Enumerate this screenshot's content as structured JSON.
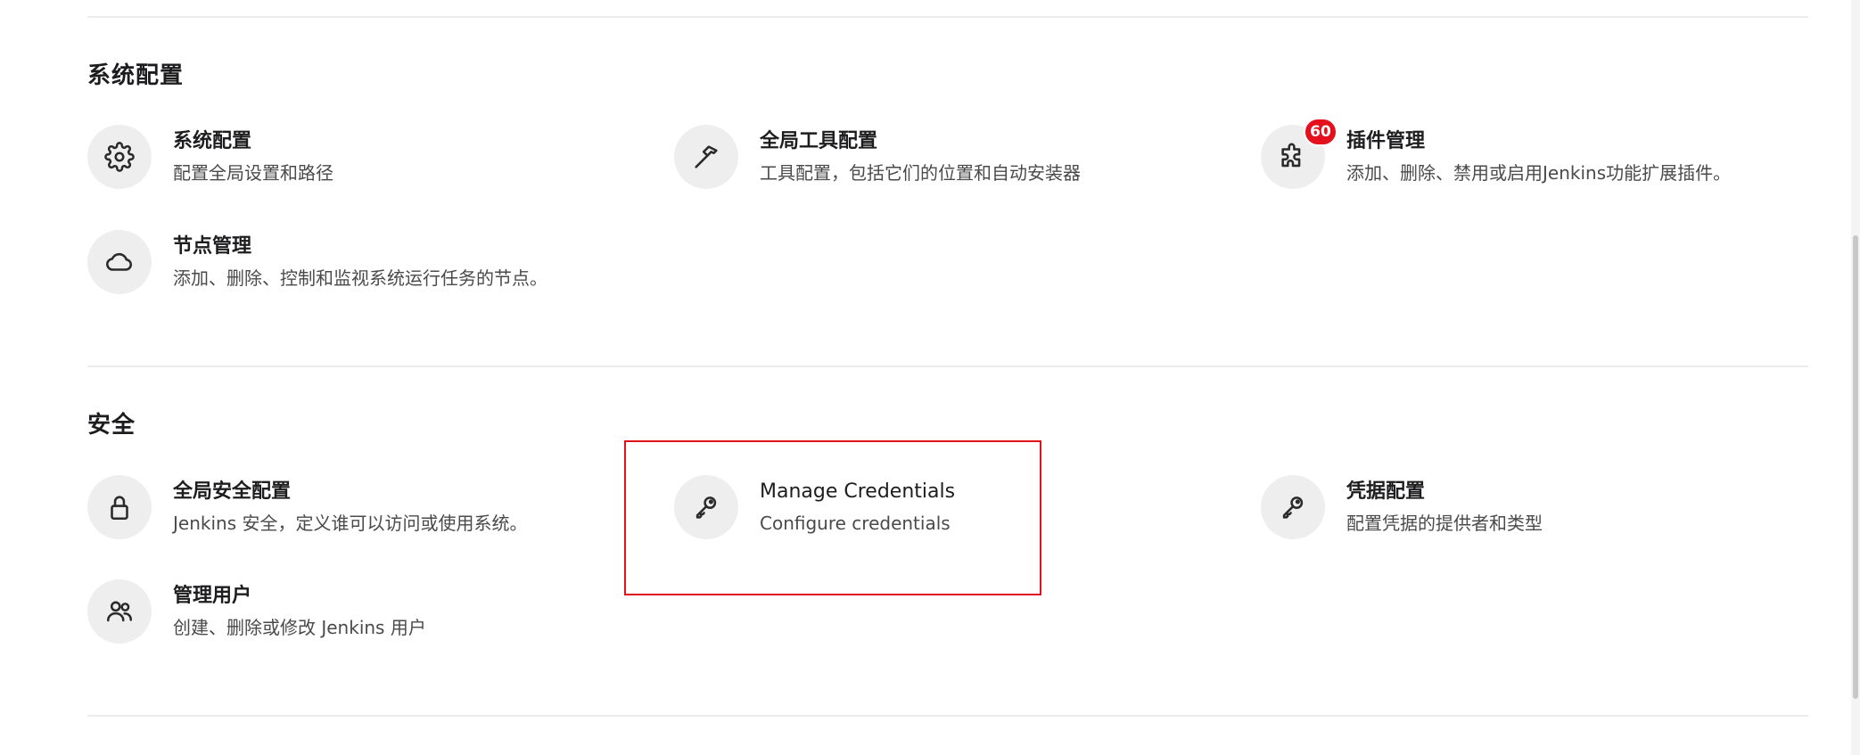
{
  "sections": {
    "system": {
      "title": "系统配置",
      "items": [
        {
          "title": "系统配置",
          "desc": "配置全局设置和路径",
          "icon": "gear-icon"
        },
        {
          "title": "全局工具配置",
          "desc": "工具配置，包括它们的位置和自动安装器",
          "icon": "hammer-icon"
        },
        {
          "title": "插件管理",
          "desc": "添加、删除、禁用或启用Jenkins功能扩展插件。",
          "icon": "puzzle-icon",
          "badge": "60"
        },
        {
          "title": "节点管理",
          "desc": "添加、删除、控制和监视系统运行任务的节点。",
          "icon": "cloud-icon"
        }
      ]
    },
    "security": {
      "title": "安全",
      "items": [
        {
          "title": "全局安全配置",
          "desc": "Jenkins 安全，定义谁可以访问或使用系统。",
          "icon": "lock-icon"
        },
        {
          "title": "Manage Credentials",
          "desc": "Configure credentials",
          "icon": "key-icon"
        },
        {
          "title": "凭据配置",
          "desc": "配置凭据的提供者和类型",
          "icon": "key-icon"
        },
        {
          "title": "管理用户",
          "desc": "创建、删除或修改 Jenkins 用户",
          "icon": "users-icon"
        }
      ]
    }
  },
  "colors": {
    "highlight": "#e0121c",
    "badge": "#e5101e",
    "icon_bg": "#eeeeee"
  }
}
